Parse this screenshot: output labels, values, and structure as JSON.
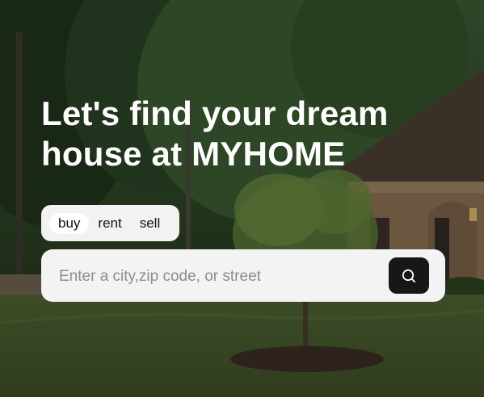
{
  "hero": {
    "headline_line1": "Let's find your dream",
    "headline_line2": "house at MYHOME",
    "background": "photo-tree-lawn-house"
  },
  "mode_tabs": {
    "items": [
      {
        "label": "buy",
        "active": true
      },
      {
        "label": "rent",
        "active": false
      },
      {
        "label": "sell",
        "active": false
      }
    ]
  },
  "search": {
    "placeholder": "Enter a city,zip code, or street",
    "value": "",
    "button_icon": "search-icon"
  },
  "colors": {
    "headline": "#ffffff",
    "panel_bg": "#f3f3f3",
    "button_bg": "#171717",
    "placeholder": "#8d8d8d"
  }
}
